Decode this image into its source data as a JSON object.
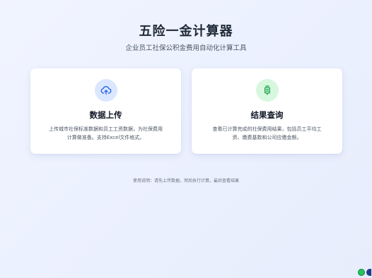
{
  "header": {
    "title": "五险一金计算器",
    "subtitle": "企业员工社保公积金费用自动化计算工具"
  },
  "cards": [
    {
      "icon": "upload-cloud-icon",
      "title": "数据上传",
      "description_line1": "上传城市社保标准数据和员工工资数据，为社保费用",
      "description_line2": "计算做准备。支持Excel文件格式。",
      "accent": "#3b82f6"
    },
    {
      "icon": "result-query-icon",
      "title": "结果查询",
      "description_line1": "查看已计算完成的社保费用结果，包括员工平均工",
      "description_line2": "资、缴费基数和公司应缴金额。",
      "accent": "#22c55e"
    }
  ],
  "footer": {
    "instructions": "使用说明：请先上传数据，然后执行计算，最后查看结果"
  },
  "colors": {
    "background": "#eef2ff",
    "card": "#ffffff",
    "title": "#1f2937",
    "blue_icon_bg": "#dbe7ff",
    "green_icon_bg": "#d8f7df"
  }
}
